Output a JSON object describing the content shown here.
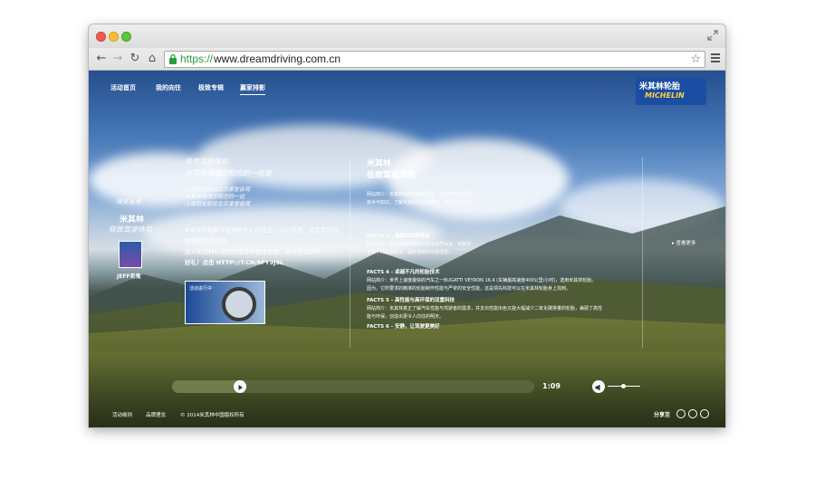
{
  "browser": {
    "url_scheme": "https://",
    "url_rest": "www.dreamdriving.com.cn"
  },
  "nav": {
    "items": [
      "活动首页",
      "我的向往",
      "极致专辑",
      "赢家排影"
    ]
  },
  "logo": {
    "brand_cn": "米其林轮胎",
    "brand_en": "MICHELIN"
  },
  "left_panel": {
    "heading": "得奖名单",
    "title": "米其林",
    "subtitle": "极致驾驶体验",
    "user_name": "JEFF老鬼"
  },
  "post": {
    "title_line1": "极致驾驶体验",
    "title_line2": "米其林邀请您和您的一位家",
    "desc_line1": "人或朋友前往北京享受自驾",
    "desc_line2": "米其林邀请您和您的一位",
    "desc_line3": "人或朋友前往北京享受自驾",
    "body_line1": "#米其林极致驾驶体验# 心向往之，行必践至。这是我的极",
    "body_line2": "致体验梦想之地。",
    "body_line3": "加入米其林开启你的极致驾驶体验吧，参与可以获得",
    "body_line4": "好礼！点击 HTTP://T.CN/8FY9J9L",
    "thumb_caption": "活动进行中"
  },
  "facts": {
    "title_line1": "米其林",
    "title_line2": "极致驾驶体验",
    "p1_line1": "网站简介：米其林全方位解析轮胎，你将学习到更多",
    "p1_line2": "技术与知识，了解米其林的品牌理念，体验极致驾驶。",
    "f3_head": "FACTS 3 - 极致的驾驶体验",
    "f3_line1": "网站简介：极为极致的驾驶体验与品质保证，米其林",
    "f3_line2": "针对不同车辆需求，提供顶级的驾驶体验。",
    "f4_head": "FACTS 4 - 卓越不凡的轮胎技术",
    "f4_line1": "网站简介：世界上速度最快的汽车之一BUGATTI VEYRON 16.4 (车辆最高速度400公里/小时)，选用米其林轮胎。",
    "f4_line2": "因为，它所要求的精准的轮胎制作性能与严苛的安全性能，这是领先科技可以在米其林轮胎身上找到。",
    "f5_head": "FACTS 5 - 高性能与高环保的双重科技",
    "f5_line1": "网站简介：米其林真正了解汽车性能与驾驶者的需求，并支出性能出色又能大幅减少二氧化碳排量的轮胎，兼顾了高性",
    "f5_line2": "能与环保，创造出更令人向往的明天。",
    "f6_head": "FACTS 6 - 安静，让驾驶更美好",
    "see_more": "查看更多"
  },
  "player": {
    "time": "1:09",
    "progress": 0.2
  },
  "footer": {
    "link1": "活动细则",
    "link2": "品牌理念",
    "copyright": "© 2014米其林中国版权所有",
    "share": "分享至"
  }
}
